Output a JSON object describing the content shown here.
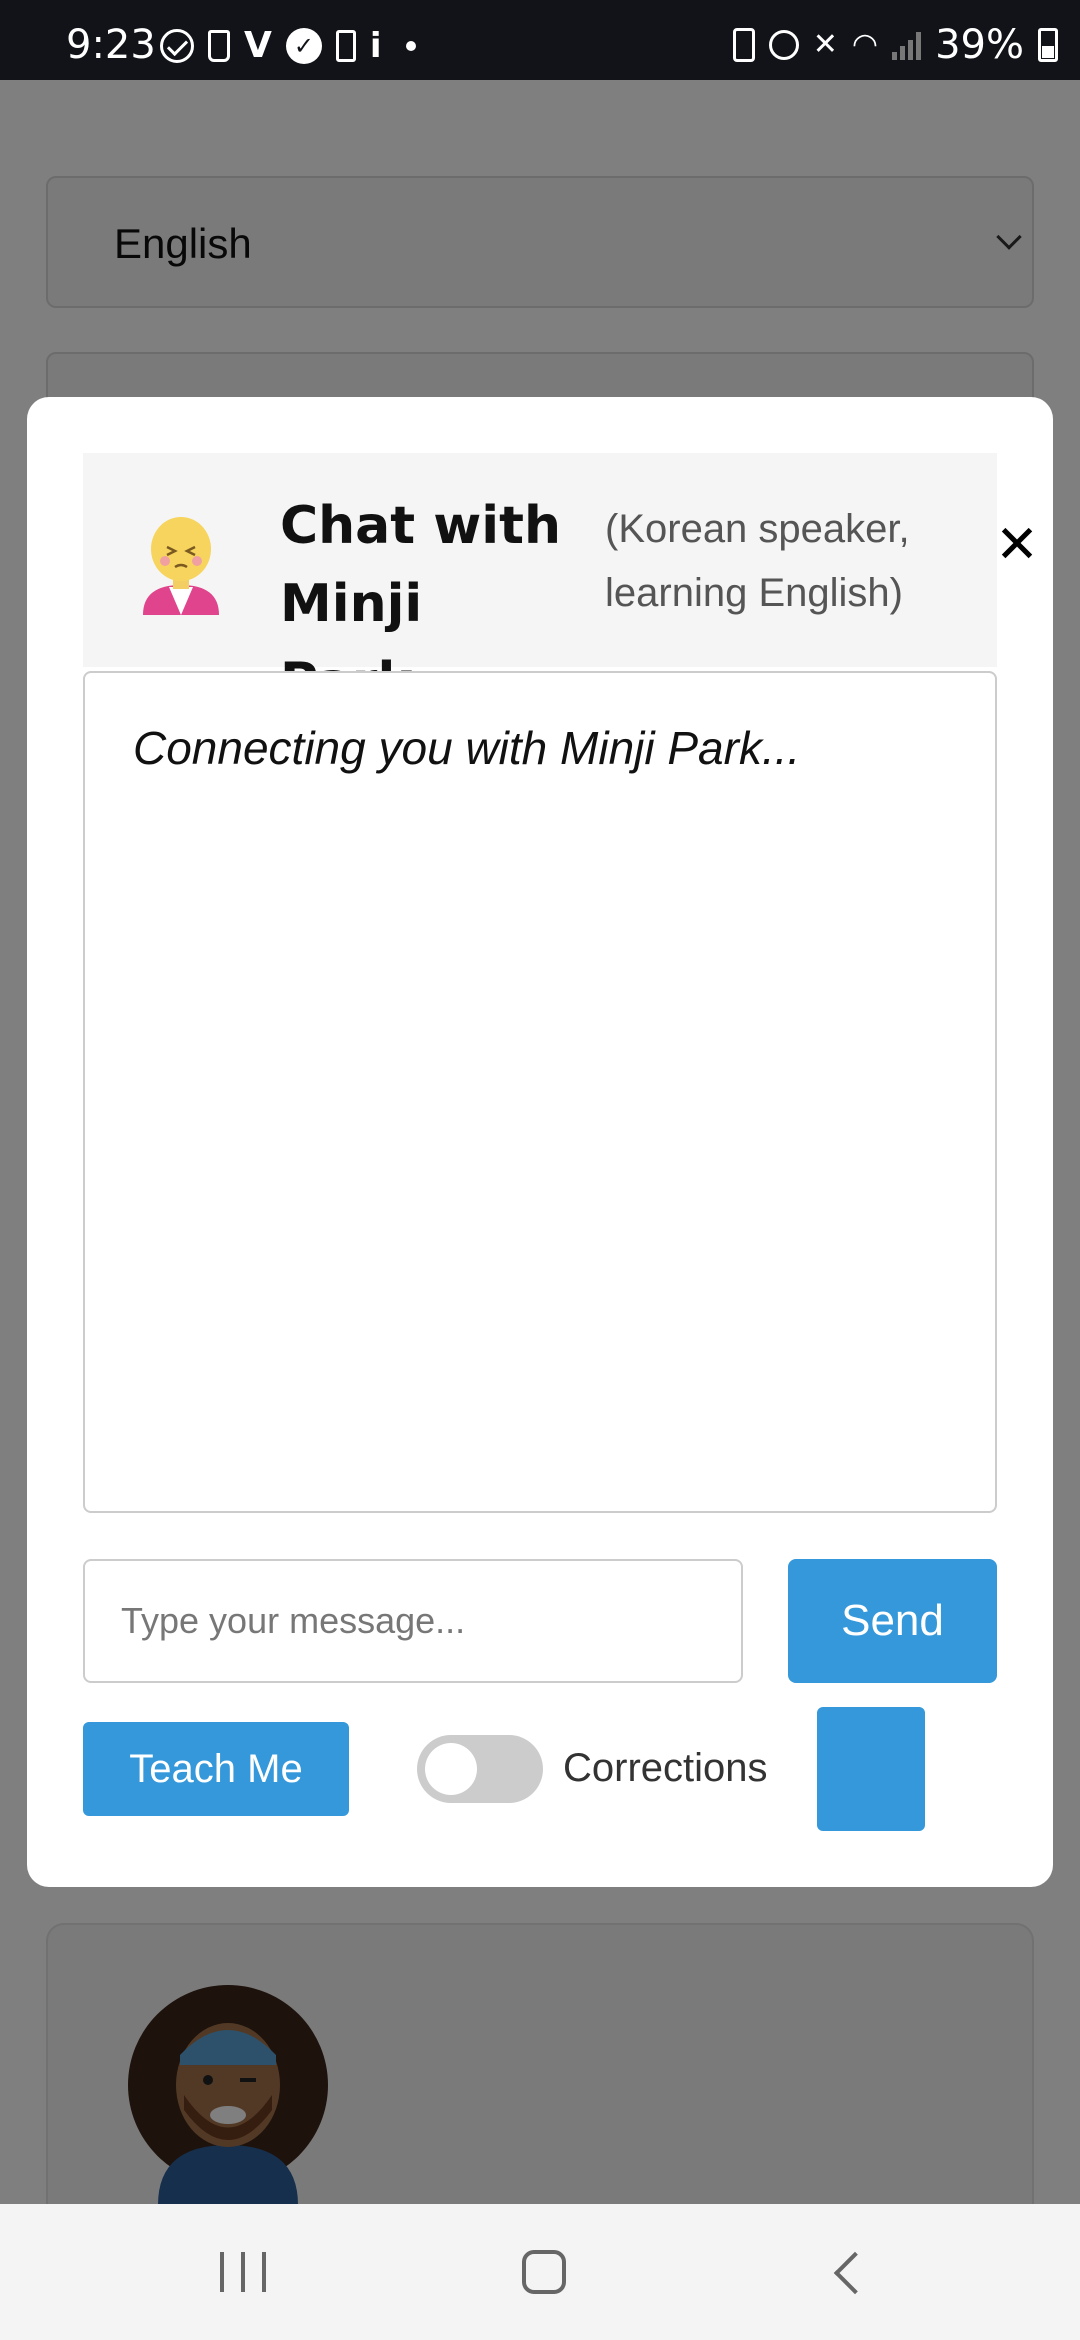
{
  "status_bar": {
    "time": "9:23",
    "battery_percent": "39%",
    "left_icons": [
      "check-circle-icon",
      "coffee-cup-icon",
      "v-logo-icon",
      "verified-icon",
      "clipboard-icon",
      "info-icon",
      "dot-icon"
    ],
    "right_icons": [
      "battery-saver-icon",
      "alarm-icon",
      "mute-icon",
      "wifi-icon",
      "signal-icon",
      "battery-icon"
    ]
  },
  "background_page": {
    "language_select_value": "English"
  },
  "chat_modal": {
    "title": "Chat with Minji Park",
    "subtitle": "(Korean speaker, learning English)",
    "close_glyph": "✕",
    "status_message": "Connecting you with Minji Park...",
    "input_placeholder": "Type your message...",
    "input_value": "",
    "send_label": "Send",
    "teach_label": "Teach Me",
    "corrections_label": "Corrections",
    "corrections_enabled": false
  },
  "colors": {
    "accent": "#3498db",
    "overlay": "rgba(0,0,0,0.5)",
    "header_bg": "#f5f5f5"
  },
  "nav_bar": {
    "icons": [
      "recents-icon",
      "home-icon",
      "back-icon"
    ]
  }
}
